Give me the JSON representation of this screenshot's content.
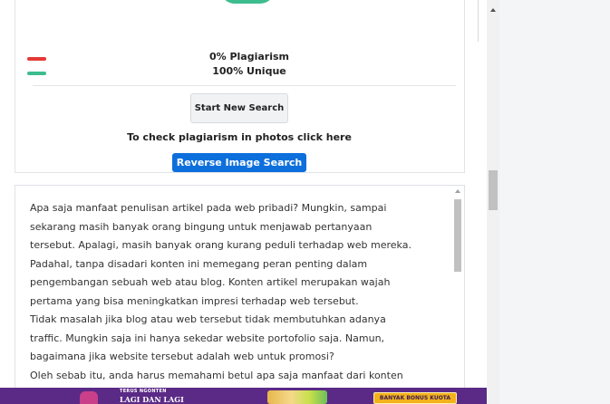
{
  "result": {
    "plagiarism": "0% Plagiarism",
    "unique": "100% Unique",
    "colors": {
      "plagiarism": "#e53935",
      "unique": "#3dbd8f"
    }
  },
  "actions": {
    "start_new_search": "Start New Search",
    "photo_prompt": "To check plagiarism in photos click here",
    "reverse_image_search": "Reverse Image Search"
  },
  "editor": {
    "lines": [
      "Apa saja manfaat penulisan artikel pada web pribadi? Mungkin, sampai",
      "sekarang masih banyak orang bingung untuk menjawab pertanyaan",
      "tersebut. Apalagi, masih banyak orang kurang peduli terhadap web mereka.",
      "Padahal, tanpa disadari konten ini memegang peran penting dalam",
      "pengembangan sebuah web atau blog. Konten artikel merupakan wajah",
      "pertama yang bisa meningkatkan impresi terhadap web tersebut.",
      "Tidak masalah jika blog atau web tersebut tidak membutuhkan adanya",
      "traffic. Mungkin saja ini hanya sekedar website portofolio saja. Namun,",
      "bagaimana jika website tersebut adalah web untuk promosi?",
      "Oleh sebab itu, anda harus memahami betul apa saja manfaat dari konten"
    ]
  },
  "ad": {
    "tagline": "TERUS NGONTEN",
    "headline": "LAGI DAN LAGI",
    "cta": "BANYAK BONUS KUOTA"
  },
  "accent": "#0d6fdc"
}
